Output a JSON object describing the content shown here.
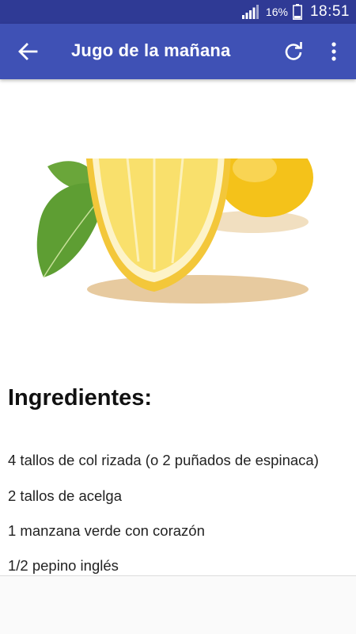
{
  "status_bar": {
    "battery_percent": "16%",
    "time": "18:51"
  },
  "toolbar": {
    "title": "Jugo de la mañana",
    "back_icon": "arrow-left-icon",
    "refresh_icon": "refresh-icon",
    "more_icon": "more-vert-icon"
  },
  "content": {
    "heading": "Ingredientes:",
    "ingredients": [
      "4 tallos de col rizada (o 2 puñados de espinaca)",
      "2 tallos de acelga",
      "1 manzana verde con corazón",
      "1/2 pepino inglés"
    ]
  },
  "colors": {
    "status_bar": "#2f3a95",
    "toolbar": "#3f51b5"
  }
}
